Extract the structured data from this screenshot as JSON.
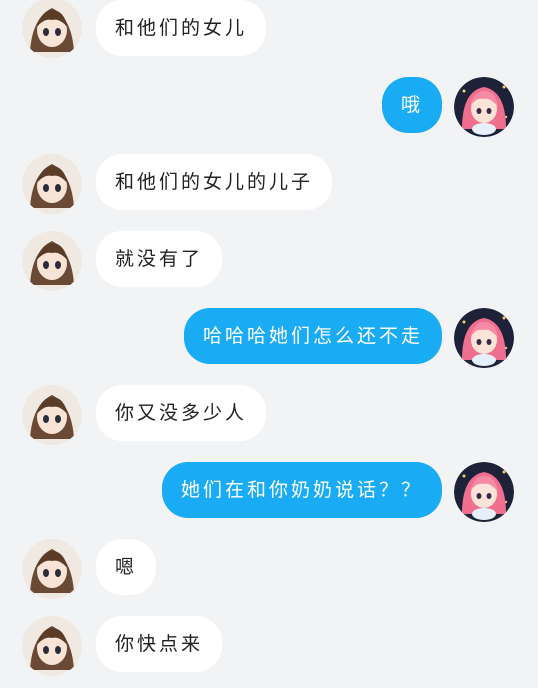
{
  "colors": {
    "background": "#f2f3f5",
    "incoming_bubble": "#ffffff",
    "outgoing_bubble": "#1aabf5"
  },
  "messages": [
    {
      "side": "in",
      "text": "和他们的女儿"
    },
    {
      "side": "out",
      "text": "哦"
    },
    {
      "side": "in",
      "text": "和他们的女儿的儿子"
    },
    {
      "side": "in",
      "text": "就没有了"
    },
    {
      "side": "out",
      "text": "哈哈哈她们怎么还不走"
    },
    {
      "side": "in",
      "text": "你又没多少人"
    },
    {
      "side": "out",
      "text": "她们在和你奶奶说话？？"
    },
    {
      "side": "in",
      "text": "嗯"
    },
    {
      "side": "in",
      "text": "你快点来"
    }
  ],
  "avatars": {
    "contact": "avatar-anime-girl-brown-hair",
    "self": "avatar-anime-girl-pink-hair"
  }
}
